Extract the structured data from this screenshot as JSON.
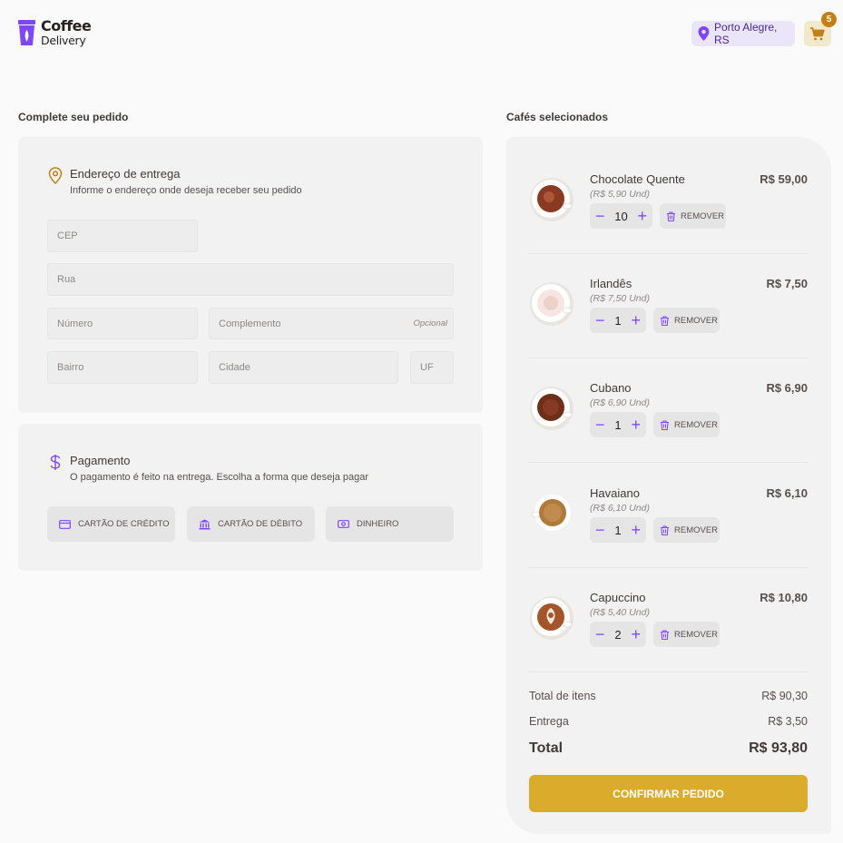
{
  "header": {
    "logo_title": "Coffee",
    "logo_subtitle": "Delivery",
    "location": "Porto Alegre, RS",
    "cart_count": "5"
  },
  "order": {
    "title": "Complete seu pedido",
    "address": {
      "title": "Endereço de entrega",
      "subtitle": "Informe o endereço onde deseja receber seu pedido",
      "fields": {
        "cep": "CEP",
        "rua": "Rua",
        "numero": "Número",
        "complemento": "Complemento",
        "complemento_optional": "Opcional",
        "bairro": "Bairro",
        "cidade": "Cidade",
        "uf": "UF"
      }
    },
    "payment": {
      "title": "Pagamento",
      "subtitle": "O pagamento é feito na entrega. Escolha a forma que deseja pagar",
      "options": [
        "Cartão de crédito",
        "Cartão de débito",
        "Dinheiro"
      ]
    }
  },
  "cart": {
    "title": "Cafés selecionados",
    "items": [
      {
        "name": "Chocolate Quente",
        "unit_price": "(R$ 5,90 Und)",
        "price": "R$ 59,00",
        "qty": "10"
      },
      {
        "name": "Irlandês",
        "unit_price": "(R$ 7,50 Und)",
        "price": "R$ 7,50",
        "qty": "1"
      },
      {
        "name": "Cubano",
        "unit_price": "(R$ 6,90 Und)",
        "price": "R$ 6,90",
        "qty": "1"
      },
      {
        "name": "Havaiano",
        "unit_price": "(R$ 6,10 Und)",
        "price": "R$ 6,10",
        "qty": "1"
      },
      {
        "name": "Capuccino",
        "unit_price": "(R$ 5,40 Und)",
        "price": "R$ 10,80",
        "qty": "2"
      }
    ],
    "remove_label": "Remover",
    "summary": {
      "items_label": "Total de itens",
      "items_value": "R$ 90,30",
      "delivery_label": "Entrega",
      "delivery_value": "R$ 3,50",
      "total_label": "Total",
      "total_value": "R$ 93,80"
    },
    "confirm_label": "Confirmar pedido"
  },
  "colors": {
    "purple": "#8047f8",
    "purple_dark": "#4b2995",
    "yellow": "#dbac2c",
    "yellow_dark": "#c47f17"
  }
}
